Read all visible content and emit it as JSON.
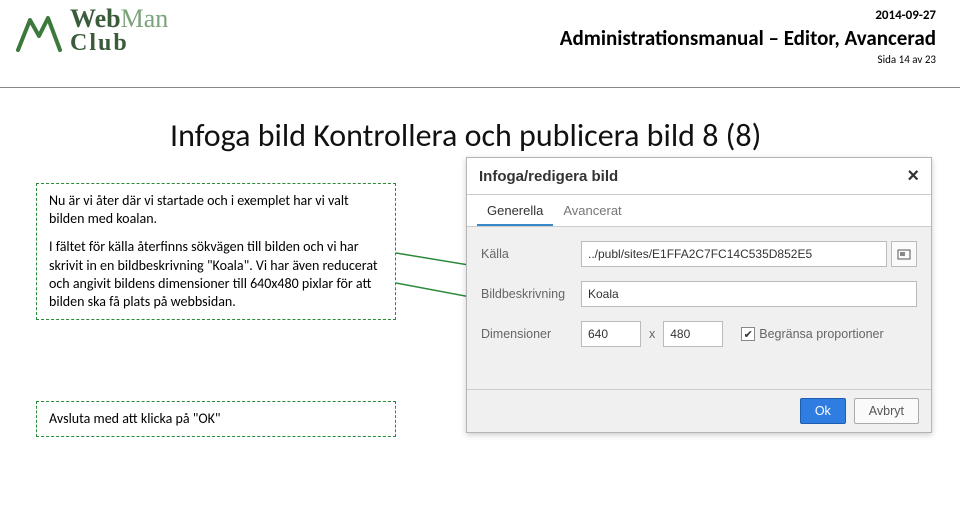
{
  "header": {
    "logo_line1_a": "Web",
    "logo_line1_b": "Man",
    "logo_line2": "Club",
    "date": "2014-09-27",
    "doc_title": "Administrationsmanual – Editor, Avancerad",
    "page_info": "Sida 14 av 23"
  },
  "heading": "Infoga bild Kontrollera och publicera bild  8 (8)",
  "callout1": {
    "p1": "Nu är vi åter där vi startade och i exemplet har vi valt bilden med koalan.",
    "p2": "I fältet för källa återfinns sökvägen till bilden och vi har skrivit in en bildbeskrivning \"Koala\". Vi har även reducerat och angivit bildens dimensioner till 640x480 pixlar för att bilden ska få plats på webbsidan."
  },
  "callout2": "Avsluta med att klicka på \"OK\"",
  "dialog": {
    "title": "Infoga/redigera bild",
    "tabs": {
      "general": "Generella",
      "advanced": "Avancerat"
    },
    "labels": {
      "source": "Källa",
      "desc": "Bildbeskrivning",
      "dim": "Dimensioner",
      "constrain": "Begränsa proportioner"
    },
    "values": {
      "source": "../publ/sites/E1FFA2C7FC14C535D852E5",
      "desc": "Koala",
      "width": "640",
      "height": "480",
      "constrain_checked": "✔"
    },
    "buttons": {
      "ok": "Ok",
      "cancel": "Avbryt"
    }
  }
}
